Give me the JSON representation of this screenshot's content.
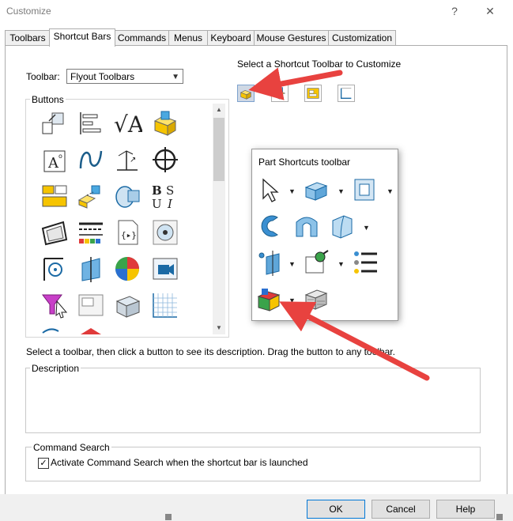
{
  "window": {
    "title": "Customize",
    "help": "?",
    "close": "✕"
  },
  "tabs": [
    {
      "label": "Toolbars"
    },
    {
      "label": "Shortcut Bars"
    },
    {
      "label": "Commands"
    },
    {
      "label": "Menus"
    },
    {
      "label": "Keyboard"
    },
    {
      "label": "Mouse Gestures"
    },
    {
      "label": "Customization"
    }
  ],
  "toolbar_select": {
    "label": "Toolbar:",
    "value": "Flyout Toolbars"
  },
  "buttons_group": {
    "title": "Buttons"
  },
  "shortcut": {
    "instruction": "Select a Shortcut Toolbar to Customize"
  },
  "popup": {
    "title": "Part Shortcuts toolbar"
  },
  "hint": "Select a toolbar, then click a button to see its description. Drag the button to any toolbar.",
  "description": {
    "title": "Description"
  },
  "command_search": {
    "title": "Command Search",
    "checkbox_label": "Activate Command Search when the shortcut bar is launched"
  },
  "footer": {
    "ok": "OK",
    "cancel": "Cancel",
    "help": "Help"
  },
  "colors": {
    "arrow": "#e8423f",
    "accent": "#0078d7"
  }
}
